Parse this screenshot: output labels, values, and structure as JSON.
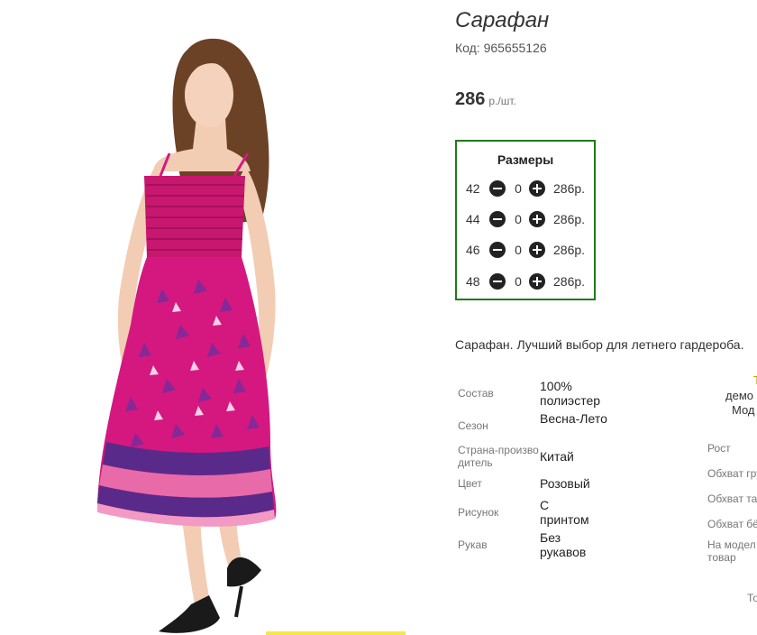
{
  "product": {
    "title": "Сарафан",
    "code": "Код: 965655126",
    "price": "286",
    "price_unit": "р./шт.",
    "description": "Сарафан. Лучший выбор для летнего гардероба."
  },
  "sizes": {
    "title": "Размеры",
    "rows": [
      {
        "size": "42",
        "qty": "0",
        "price": "286р."
      },
      {
        "size": "44",
        "qty": "0",
        "price": "286р."
      },
      {
        "size": "46",
        "qty": "0",
        "price": "286р."
      },
      {
        "size": "48",
        "qty": "0",
        "price": "286р."
      }
    ]
  },
  "attributes": [
    {
      "label": "Состав",
      "value": "100% полиэстер"
    },
    {
      "label": "Сезон",
      "value": "Весна-Лето"
    },
    {
      "label": "Страна-производитель",
      "value": "Китай"
    },
    {
      "label": "Цвет",
      "value": "Розовый"
    },
    {
      "label": "Рисунок",
      "value": "С принтом"
    },
    {
      "label": "Рукав",
      "value": "Без рукавов"
    }
  ],
  "model_panel": {
    "top1": "Т",
    "top2": "демо",
    "top3": "Мод",
    "rows": [
      "Рост",
      "Обхват гру",
      "Обхват та",
      "Обхват бё",
      "На модел",
      "товар"
    ],
    "bottom": "То"
  },
  "colors": {
    "border_green": "#1d7a1d",
    "dress_pink": "#d4187f",
    "dress_purple": "#5a2a8a"
  }
}
